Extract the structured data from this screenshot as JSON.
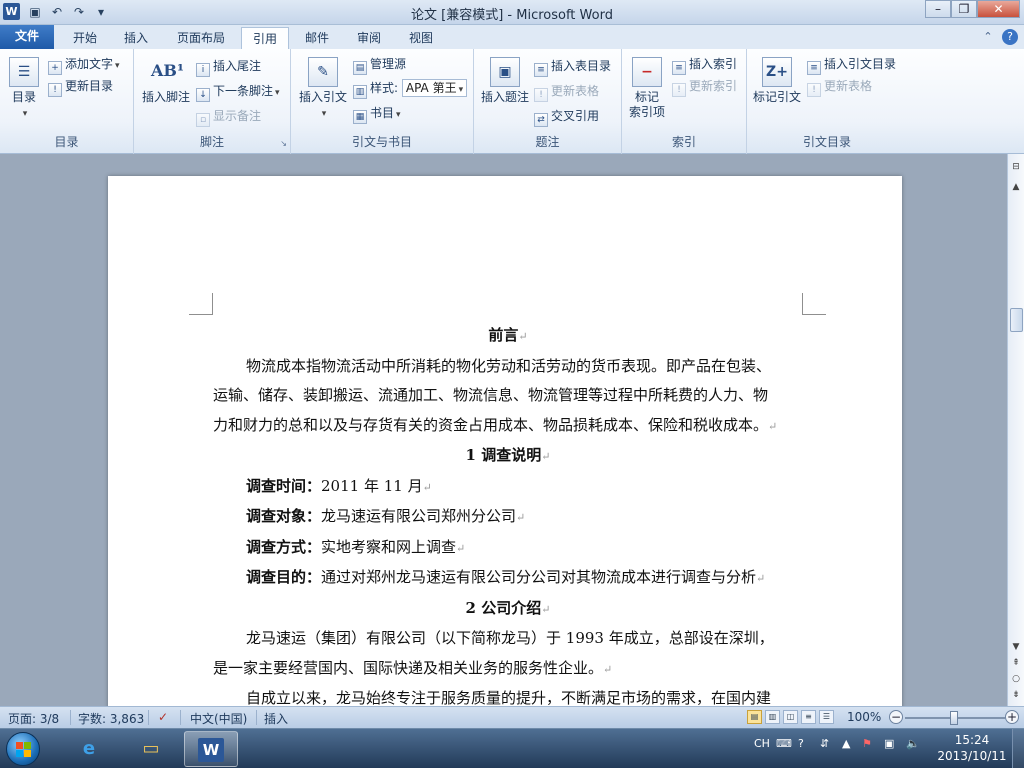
{
  "window": {
    "title": "论文 [兼容模式] - Microsoft Word",
    "app_icon": "W",
    "controls": [
      "minimize-icon",
      "maximize-icon",
      "close-icon"
    ]
  },
  "ribbon_tabs": {
    "file": "文件",
    "home": "开始",
    "insert": "插入",
    "layout": "页面布局",
    "references": "引用",
    "mailings": "邮件",
    "review": "审阅",
    "view": "视图",
    "active": "引用"
  },
  "ribbon": {
    "toc": {
      "label": "目录",
      "toc_button": "目录",
      "add_text": "添加文字",
      "update_toc": "更新目录"
    },
    "footnotes": {
      "label": "脚注",
      "insert_footnote": "插入脚注",
      "insert_endnote": "插入尾注",
      "next_footnote": "下一条脚注",
      "show_notes": "显示备注"
    },
    "citations": {
      "label": "引文与书目",
      "insert_citation": "插入引文",
      "manage_sources": "管理源",
      "style_label": "样式:",
      "style_value": "APA 第王",
      "bibliography": "书目"
    },
    "captions": {
      "label": "题注",
      "insert_caption": "插入题注",
      "insert_table_of_figures": "插入表目录",
      "update_table": "更新表格",
      "cross_reference": "交叉引用"
    },
    "index": {
      "label": "索引",
      "mark_entry_line1": "标记",
      "mark_entry_line2": "索引项",
      "insert_index": "插入索引",
      "update_index": "更新索引"
    },
    "authorities": {
      "label": "引文目录",
      "mark_citation": "标记引文",
      "insert_toa": "插入引文目录",
      "update_table": "更新表格"
    }
  },
  "document": {
    "heading_preface": "前言",
    "p1_line1": "物流成本指物流活动中所消耗的物化劳动和活劳动的货币表现。即产品在包装、",
    "p1_line2": "运输、储存、装卸搬运、流通加工、物流信息、物流管理等过程中所耗费的人力、物",
    "p1_line3": "力和财力的总和以及与存货有关的资金占用成本、物品损耗成本、保险和税收成本。",
    "heading_1": "1  调查说明",
    "survey_time_label": "调查时间：",
    "survey_time_value": "2011 年 11 月",
    "survey_object_label": "调查对象：",
    "survey_object_value": "龙马速运有限公司郑州分公司",
    "survey_method_label": "调查方式：",
    "survey_method_value": "实地考察和网上调查",
    "survey_goal_label": "调查目的：",
    "survey_goal_value": "通过对郑州龙马速运有限公司分公司对其物流成本进行调查与分析",
    "heading_2": "2  公司介绍",
    "p2_line1": "龙马速运（集团）有限公司（以下简称龙马）于 1993 年成立，总部设在深圳，",
    "p2_line2": "是一家主要经营国内、国际快递及相关业务的服务性企业。",
    "p3_line1": "自成立以来，龙马始终专注于服务质量的提升，不断满足市场的需求，在国内建",
    "paragraph_mark": "↵"
  },
  "statusbar": {
    "page": "页面: 3/8",
    "words": "字数: 3,863",
    "language": "中文(中国)",
    "mode": "插入",
    "zoom": "100%"
  },
  "taskbar": {
    "ime": "CH",
    "time": "15:24",
    "date": "2013/10/11"
  }
}
